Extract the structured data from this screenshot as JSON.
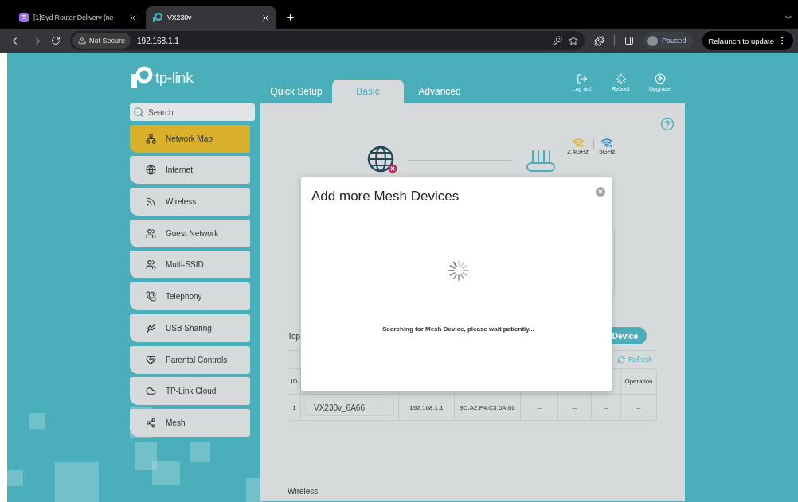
{
  "browser": {
    "tabs": [
      {
        "title": "[1]Syd Router Delivery (ne",
        "selected": false
      },
      {
        "title": "VX230v",
        "selected": true
      }
    ],
    "address": {
      "security": "Not Secure",
      "url": "192.168.1.1"
    },
    "profile": "Paused",
    "update_button": "Relaunch to update"
  },
  "router": {
    "logo": "tp-link",
    "tabs": [
      {
        "label": "Quick Setup",
        "selected": false
      },
      {
        "label": "Basic",
        "selected": true
      },
      {
        "label": "Advanced",
        "selected": false
      }
    ],
    "actions": [
      "Log out",
      "Reboot",
      "Upgrade"
    ],
    "search": {
      "placeholder": "Search"
    },
    "sidebar": {
      "items": [
        {
          "label": "Network Map",
          "selected": true
        },
        {
          "label": "Internet",
          "selected": false
        },
        {
          "label": "Wireless",
          "selected": false
        },
        {
          "label": "Guest Network",
          "selected": false
        },
        {
          "label": "Multi-SSID",
          "selected": false
        },
        {
          "label": "Telephony",
          "selected": false
        },
        {
          "label": "USB Sharing",
          "selected": false
        },
        {
          "label": "Parental Controls",
          "selected": false
        },
        {
          "label": "TP-Link Cloud",
          "selected": false
        },
        {
          "label": "Mesh",
          "selected": false
        }
      ]
    },
    "network_map": {
      "bands": [
        {
          "label": "2.4GHz",
          "color": "#e8b420"
        },
        {
          "label": "5GHz",
          "color": "#2f8fd0"
        }
      ]
    },
    "topology": {
      "label": "Top",
      "add_button": "Device",
      "refresh": "Refresh",
      "table": {
        "columns": [
          "ID",
          "",
          "",
          "",
          "",
          "",
          "",
          "Operation"
        ],
        "rows": [
          {
            "cells": [
              "1",
              "VX230v_6A66",
              "192.168.1.1",
              "9C:A2:F4:C3:6A:66",
              "--",
              "--",
              "--",
              "--"
            ]
          }
        ]
      }
    },
    "section_label": "Wireless"
  },
  "modal": {
    "title": "Add more Mesh Devices",
    "message": "Searching for Mesh Device, please wait patiently..."
  }
}
